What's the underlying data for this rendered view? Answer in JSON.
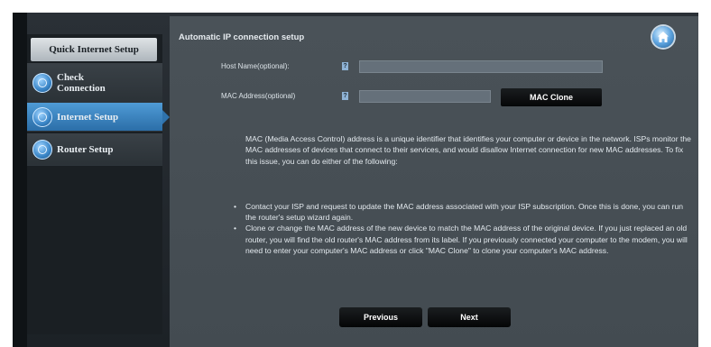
{
  "sidebar": {
    "header": "Quick Internet Setup",
    "items": [
      {
        "label_line1": "Check",
        "label_line2": "Connection"
      },
      {
        "label": "Internet Setup"
      },
      {
        "label": "Router Setup"
      }
    ]
  },
  "panel": {
    "title": "Automatic IP connection setup",
    "host_name_label": "Host Name(optional):",
    "mac_address_label": "MAC Address(optional)",
    "help_icon": "?",
    "host_name_value": "",
    "mac_address_value": "",
    "mac_clone_label": "MAC Clone",
    "description": "MAC (Media Access Control) address is a unique identifier that identifies your computer or device in the network. ISPs monitor the MAC addresses of devices that connect to their services, and would disallow Internet connection for new MAC addresses. To fix this issue, you can do either of the following:",
    "bullets": [
      "Contact your ISP and request to update the MAC address associated with your ISP subscription. Once this is done, you can run the router's setup wizard again.",
      "Clone or change the MAC address of the new device to match the MAC address of the original device. If you just replaced an old router, you will find the old router's MAC address from its label. If you previously connected your computer to the modem, you will need to enter your computer's MAC address or click \"MAC Clone\" to clone your computer's MAC address."
    ],
    "previous_label": "Previous",
    "next_label": "Next"
  },
  "icons": {
    "home": "home-icon",
    "sidebar": "globe-icon"
  },
  "colors": {
    "accent": "#2b6ea8",
    "panel_bg": "#4a5258",
    "sidebar_bg": "#1a1f23"
  }
}
